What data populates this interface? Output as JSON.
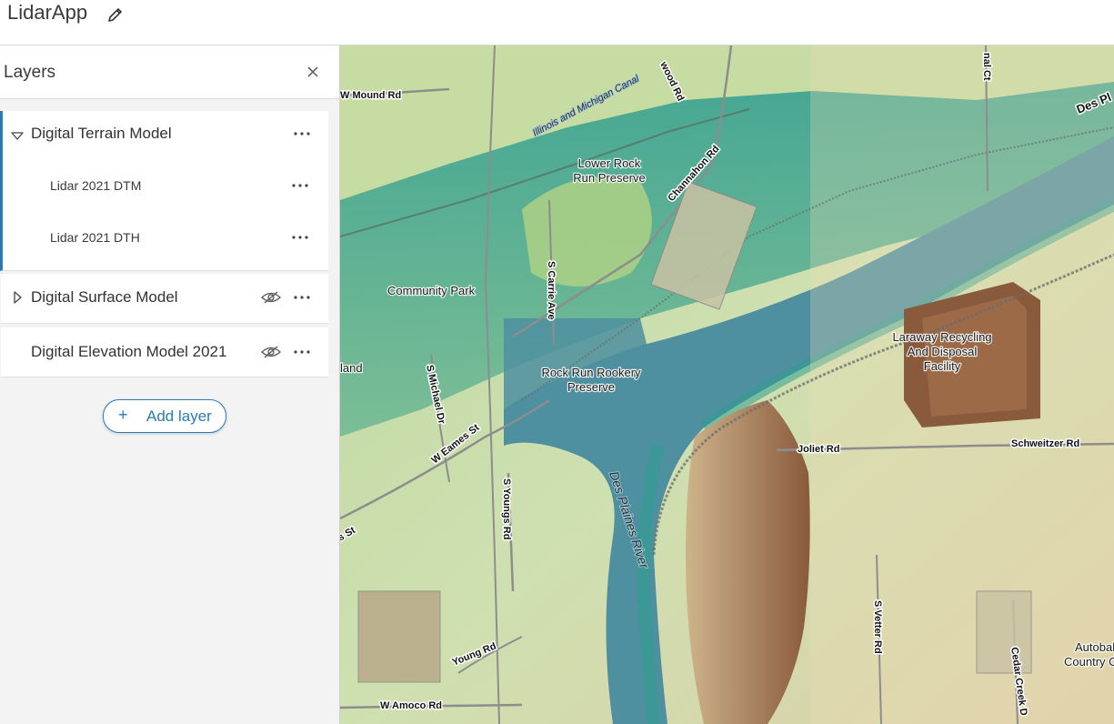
{
  "app": {
    "title": "LidarApp",
    "edit_icon": "pencil-icon"
  },
  "panel": {
    "title": "Layers",
    "close_icon": "close-icon",
    "layers": [
      {
        "label": "Digital Terrain Model",
        "expanded": true,
        "icon": "chevron-down-icon",
        "children": [
          {
            "label": "Lidar 2021 DTM"
          },
          {
            "label": "Lidar 2021 DTH"
          }
        ]
      },
      {
        "label": "Digital Surface Model",
        "expanded": false,
        "icon": "chevron-right-icon",
        "visibility_icon": "eye-icon"
      },
      {
        "label": "Digital Elevation Model 2021",
        "visibility_icon": "eye-icon"
      }
    ],
    "add_button": {
      "label": "Add layer",
      "icon": "plus-icon"
    }
  },
  "map": {
    "roads": {
      "mound": "W Mound Rd",
      "wood": "wood Rd",
      "canal_ct": "nal Ct",
      "des_pl": "Des Pl",
      "chan": "Channahon Rd",
      "carrie": "S Carrie Ave",
      "michael": "S Michael Dr",
      "eames": "W Eames St",
      "youngs": "S Youngs Rd",
      "st": "s St",
      "young": "Young Rd",
      "amoco": "W Amoco Rd",
      "joliet": "Joliet Rd",
      "schweitzer": "Schweitzer Rd",
      "vetter": "S Vetter Rd",
      "cedar": "Cedar Creek D"
    },
    "places": {
      "lower1": "Lower Rock",
      "lower2": "Run Preserve",
      "community": "Community Park",
      "rookery1": "Rock Run Rookery",
      "rookery2": "Preserve",
      "laraway1": "Laraway Recycling",
      "laraway2": "And Disposal",
      "laraway3": "Facility",
      "land": "land",
      "auto1": "Autobah",
      "auto2": "Country C"
    },
    "water": {
      "canal": "Illinois and Michigan Canal",
      "river": "Des Plaines River"
    },
    "colors": {
      "water": "#4e8fa0",
      "low": "#2f9e8f",
      "mid": "#9ac88c",
      "high": "#d7caa0",
      "peak": "#8a5a3c"
    }
  }
}
